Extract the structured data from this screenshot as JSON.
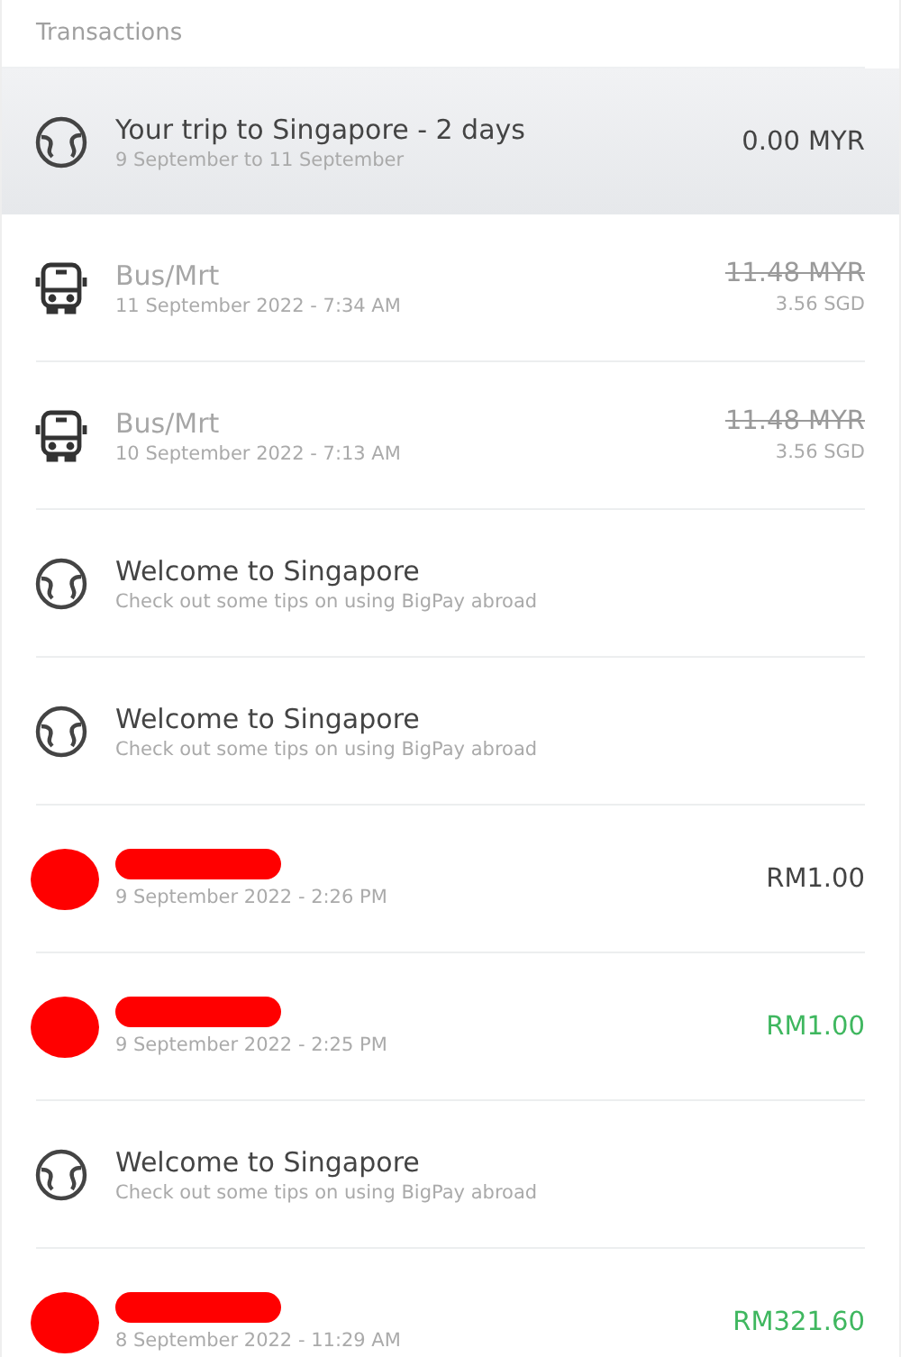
{
  "header": {
    "title": "Transactions"
  },
  "transactions": [
    {
      "kind": "trip",
      "selected": true,
      "title": "Your trip to Singapore - 2 days",
      "subtitle": "9 September to 11 September",
      "amount": "0.00 MYR"
    },
    {
      "kind": "transport",
      "selected": false,
      "cancelled": true,
      "title": "Bus/Mrt",
      "subtitle": "11 September 2022 - 7:34 AM",
      "amount": "11.48 MYR",
      "secondary_amount": "3.56 SGD"
    },
    {
      "kind": "transport",
      "selected": false,
      "cancelled": true,
      "title": "Bus/Mrt",
      "subtitle": "10 September 2022 - 7:13 AM",
      "amount": "11.48 MYR",
      "secondary_amount": "3.56 SGD"
    },
    {
      "kind": "tip",
      "selected": false,
      "title": "Welcome to Singapore",
      "subtitle": "Check out some tips on using BigPay abroad"
    },
    {
      "kind": "tip",
      "selected": false,
      "title": "Welcome to Singapore",
      "subtitle": "Check out some tips on using BigPay abroad"
    },
    {
      "kind": "payment",
      "selected": false,
      "redacted": true,
      "credit": false,
      "subtitle": "9 September 2022 - 2:26 PM",
      "amount": "RM1.00"
    },
    {
      "kind": "payment",
      "selected": false,
      "redacted": true,
      "credit": true,
      "subtitle": "9 September 2022 - 2:25 PM",
      "amount": "RM1.00"
    },
    {
      "kind": "tip",
      "selected": false,
      "title": "Welcome to Singapore",
      "subtitle": "Check out some tips on using BigPay abroad"
    },
    {
      "kind": "payment",
      "selected": false,
      "redacted": true,
      "credit": true,
      "subtitle": "8 September 2022 - 11:29 AM",
      "amount": "RM321.60"
    }
  ]
}
